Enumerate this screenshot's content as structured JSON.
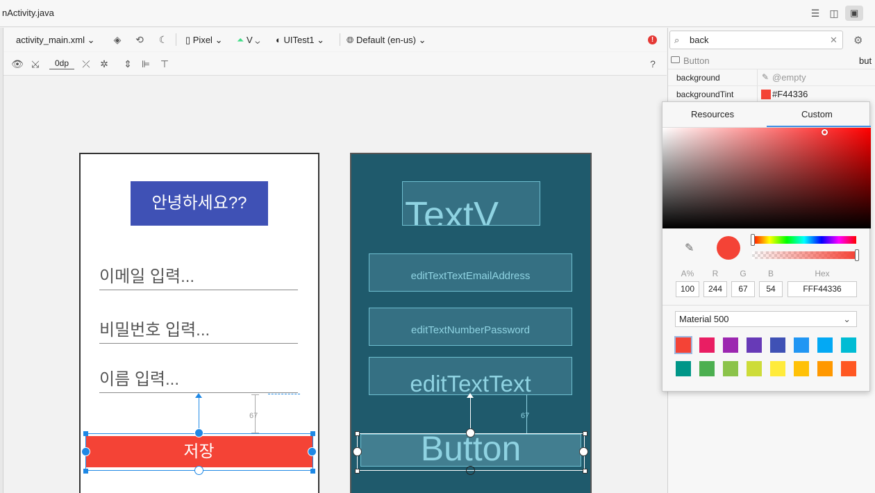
{
  "titlebar": {
    "tab_title": "nActivity.java"
  },
  "toolbar": {
    "file": "activity_main.xml",
    "device": "Pixel",
    "api": "V",
    "theme": "UITest1",
    "locale": "Default (en-us)",
    "margin": "0dp",
    "help": "?"
  },
  "design": {
    "title": "안녕하세요??",
    "email_hint": "이메일 입력...",
    "password_hint": "비밀번호 입력...",
    "name_hint": "이름 입력...",
    "save_label": "저장",
    "margin_value": "67",
    "colors": {
      "title_bg": "#3f51b5",
      "button_bg": "#f44336",
      "selection": "#1e88e5"
    }
  },
  "blueprint": {
    "textview": "TextV",
    "email": "editTextTextEmailAddress",
    "password": "editTextNumberPassword",
    "name": "editTextText",
    "button": "Button",
    "margin_value": "67",
    "background": "#1f5a6c"
  },
  "attributes": {
    "search_value": "back",
    "component": "Button",
    "component_id": "but",
    "rows": [
      {
        "name": "background",
        "value": "@empty"
      },
      {
        "name": "backgroundTint",
        "value": "#F44336"
      }
    ]
  },
  "picker": {
    "tabs": [
      "Resources",
      "Custom"
    ],
    "active_tab": "Custom",
    "current_color": "#F44336",
    "labels": {
      "alpha": "A%",
      "r": "R",
      "g": "G",
      "b": "B",
      "hex": "Hex"
    },
    "values": {
      "alpha": "100",
      "r": "244",
      "g": "67",
      "b": "54",
      "hex": "FFF44336"
    },
    "palette": "Material 500",
    "swatches": [
      "#f44336",
      "#e91e63",
      "#9c27b0",
      "#673ab7",
      "#3f51b5",
      "#2196f3",
      "#03a9f4",
      "#00bcd4",
      "#009688",
      "#4caf50",
      "#8bc34a",
      "#cddc39",
      "#ffeb3b",
      "#ffc107",
      "#ff9800",
      "#ff5722"
    ]
  }
}
